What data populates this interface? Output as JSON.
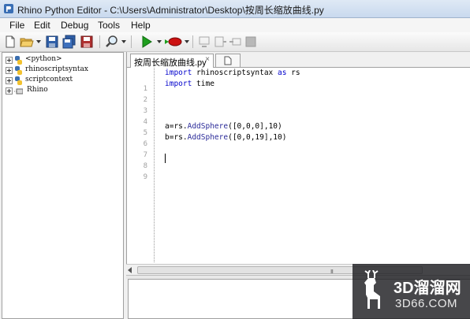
{
  "window": {
    "title": "Rhino Python Editor - C:\\Users\\Administrator\\Desktop\\按周长缩放曲线.py"
  },
  "menu": [
    "File",
    "Edit",
    "Debug",
    "Tools",
    "Help"
  ],
  "toolbar_icons": [
    "new-file-icon",
    "open-folder-icon",
    "save-icon",
    "save-all-icon",
    "save-as-icon",
    "find-icon",
    "run-icon",
    "debug-icon",
    "step-into-icon",
    "step-over-icon",
    "step-out-icon",
    "stop-icon"
  ],
  "tree": [
    {
      "label": "<python>",
      "icon": "python-module-icon"
    },
    {
      "label": "rhinoscriptsyntax",
      "icon": "python-module-icon"
    },
    {
      "label": "scriptcontext",
      "icon": "python-module-icon"
    },
    {
      "label": "Rhino",
      "icon": "assembly-icon"
    }
  ],
  "editor": {
    "tab_label": "按周长缩放曲线.py",
    "tab_close": "×",
    "line_numbers": [
      "1",
      "2",
      "3",
      "4",
      "5",
      "6",
      "7",
      "8",
      "9"
    ],
    "lines": [
      "import rhinoscriptsyntax as rs",
      "import time",
      "",
      "",
      "",
      "a=rs.AddSphere([0,0,0],10)",
      "b=rs.AddSphere([0,0,19],10)",
      "",
      ""
    ],
    "scroll_grip": "III"
  },
  "watermark": {
    "line1": "3D溜溜网",
    "line2": "3D66.COM"
  },
  "colors": {
    "keyword": "#0000cc",
    "function": "#2b2b99",
    "run_green": "#1e9e1e"
  }
}
